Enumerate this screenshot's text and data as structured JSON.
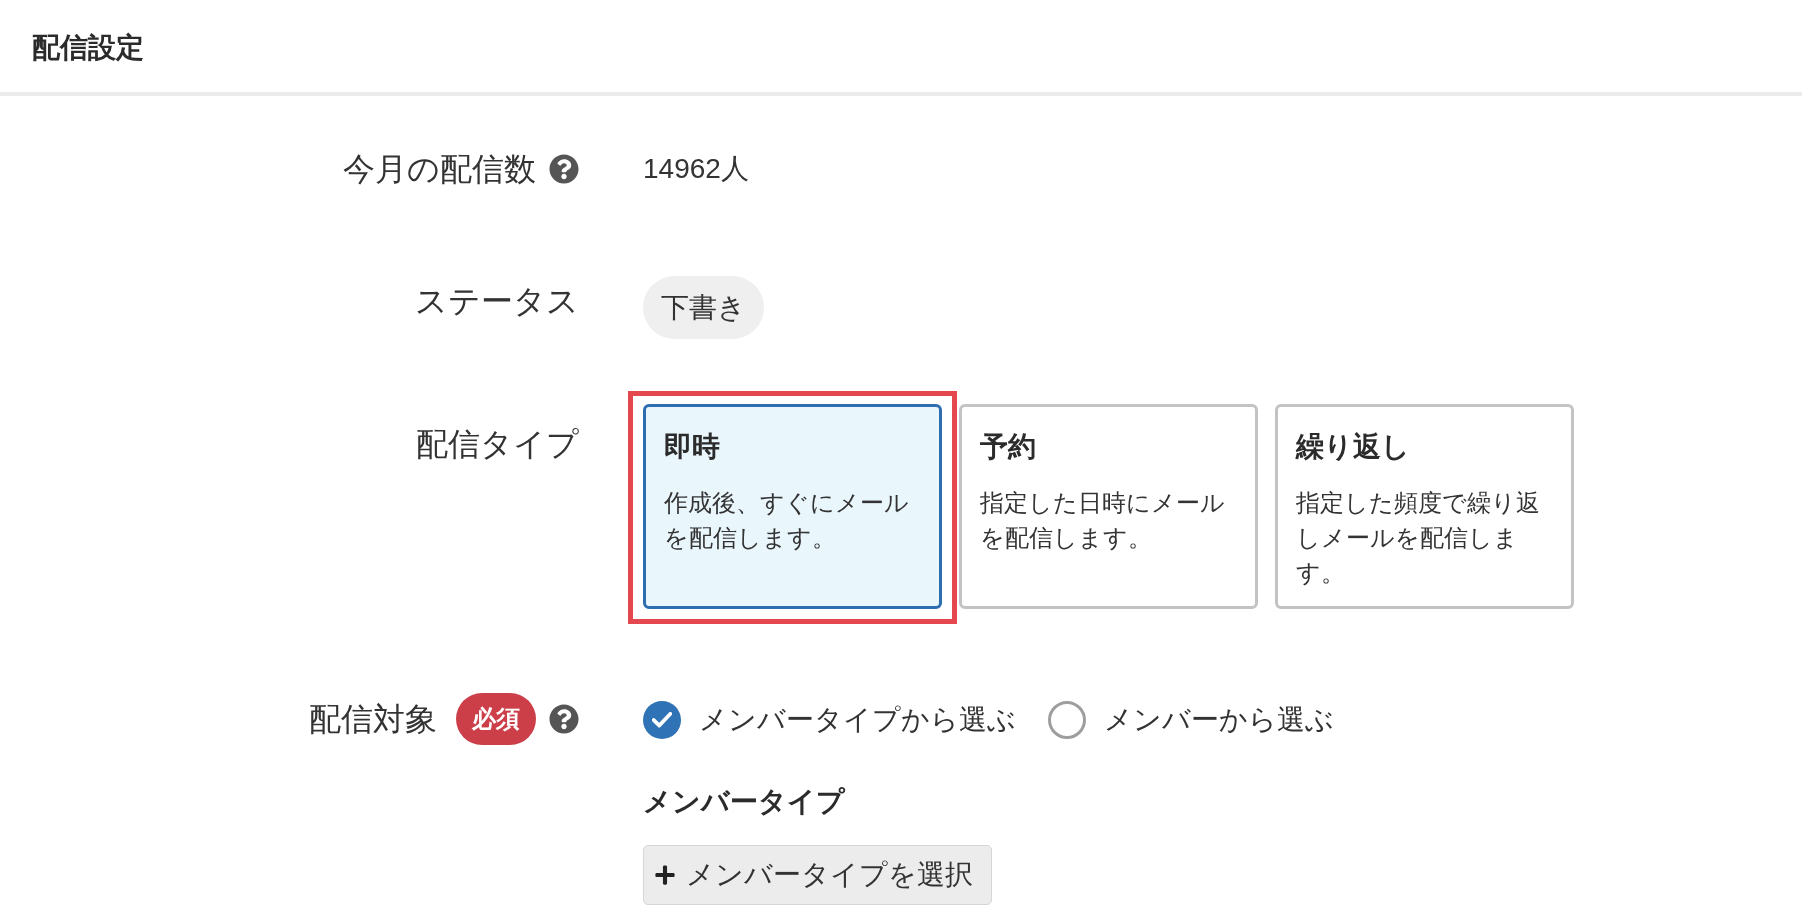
{
  "header": {
    "title": "配信設定"
  },
  "form": [
    {
      "kind": "text",
      "label": "今月の配信数",
      "help": true,
      "required": false,
      "value": "14962人"
    },
    {
      "kind": "status",
      "label": "ステータス",
      "help": false,
      "required": false,
      "badge": "下書き"
    },
    {
      "kind": "cards",
      "label": "配信タイプ",
      "help": false,
      "required": false,
      "options": [
        {
          "title": "即時",
          "description": "作成後、すぐにメールを配信します。",
          "selected": true,
          "highlighted": true
        },
        {
          "title": "予約",
          "description": "指定した日時にメールを配信します。",
          "selected": false,
          "highlighted": false
        },
        {
          "title": "繰り返し",
          "description": "指定した頻度で繰り返しメールを配信します。",
          "selected": false,
          "highlighted": false
        }
      ]
    },
    {
      "kind": "target",
      "label": "配信対象",
      "help": true,
      "required": true,
      "required_text": "必須",
      "options": [
        {
          "label": "メンバータイプから選ぶ",
          "selected": true
        },
        {
          "label": "メンバーから選ぶ",
          "selected": false
        }
      ],
      "subsection": {
        "title": "メンバータイプ",
        "button": "メンバータイプを選択"
      }
    }
  ]
}
